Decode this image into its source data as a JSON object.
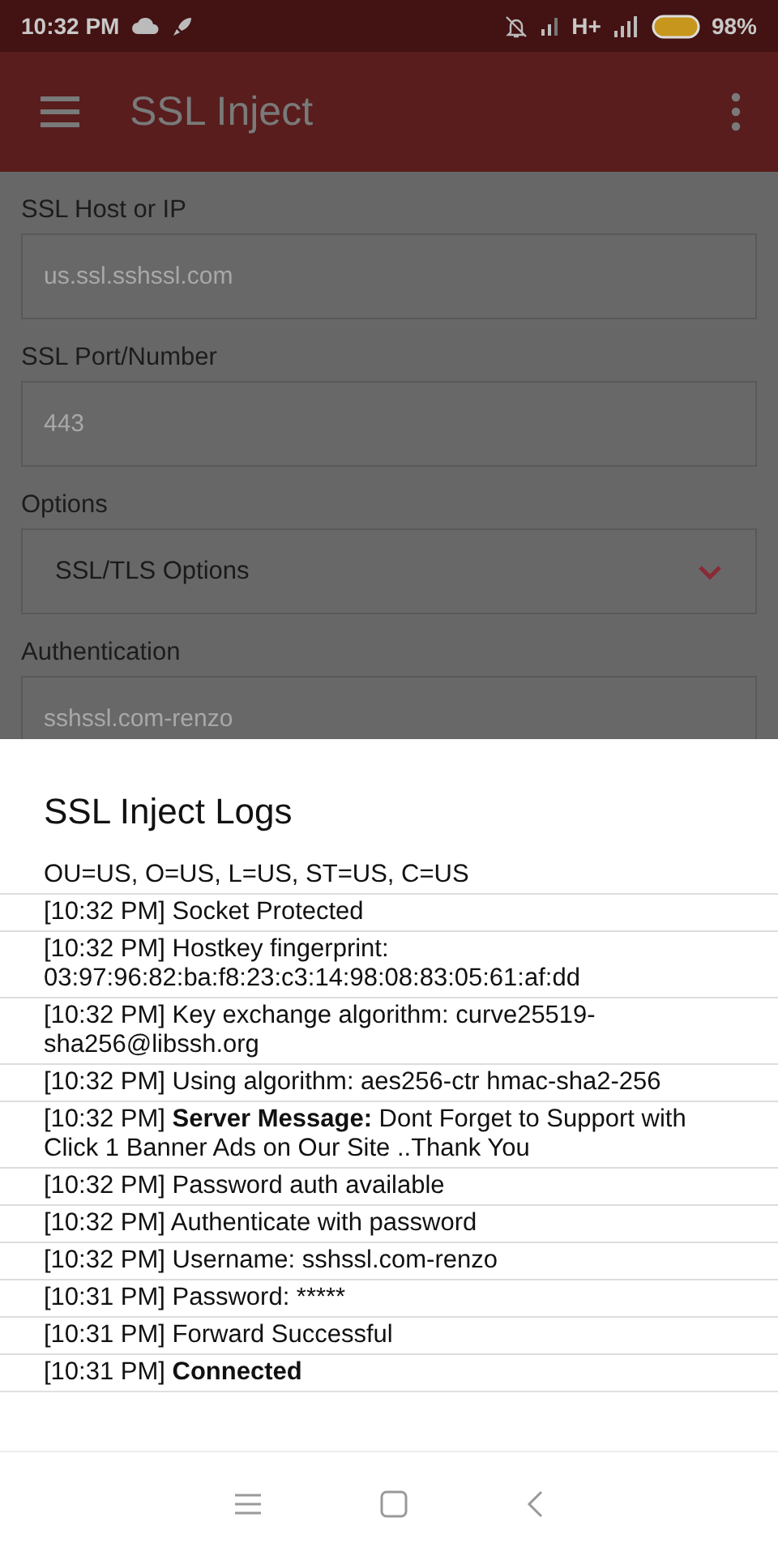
{
  "status_bar": {
    "time": "10:32 PM",
    "network": "H+",
    "battery": "98%"
  },
  "app_bar": {
    "title": "SSL Inject"
  },
  "form": [
    {
      "kind": "text",
      "label": "SSL Host or IP",
      "placeholder": "us.ssl.sshssl.com"
    },
    {
      "kind": "text",
      "label": "SSL Port/Number",
      "placeholder": "443"
    },
    {
      "kind": "select",
      "label": "Options",
      "value": "SSL/TLS Options"
    },
    {
      "kind": "text",
      "label": "Authentication",
      "placeholder": "sshssl.com-renzo"
    }
  ],
  "logs_sheet": {
    "title": "SSL Inject Logs",
    "entries": [
      {
        "kind": "plain",
        "text": "OU=US, O=US, L=US, ST=US, C=US"
      },
      {
        "kind": "plain",
        "text": "[10:32 PM] Socket Protected"
      },
      {
        "kind": "plain",
        "text": "[10:32 PM] Hostkey fingerprint: 03:97:96:82:ba:f8:23:c3:14:98:08:83:05:61:af:dd"
      },
      {
        "kind": "plain",
        "text": "[10:32 PM] Key exchange algorithm: curve25519-sha256@libssh.org"
      },
      {
        "kind": "plain",
        "text": "[10:32 PM] Using algorithm: aes256-ctr hmac-sha2-256"
      },
      {
        "kind": "rich",
        "text": "[10:32 PM] **Server Message:** Dont Forget to Support with Click 1 Banner Ads on Our Site ..Thank You"
      },
      {
        "kind": "plain",
        "text": "[10:32 PM] Password auth available"
      },
      {
        "kind": "plain",
        "text": "[10:32 PM] Authenticate with password"
      },
      {
        "kind": "plain",
        "text": "[10:32 PM] Username: sshssl.com-renzo"
      },
      {
        "kind": "plain",
        "text": "[10:31 PM] Password: *****"
      },
      {
        "kind": "plain",
        "text": "[10:31 PM] Forward Successful"
      },
      {
        "kind": "rich",
        "text": "[10:31 PM] **Connected**"
      }
    ]
  }
}
